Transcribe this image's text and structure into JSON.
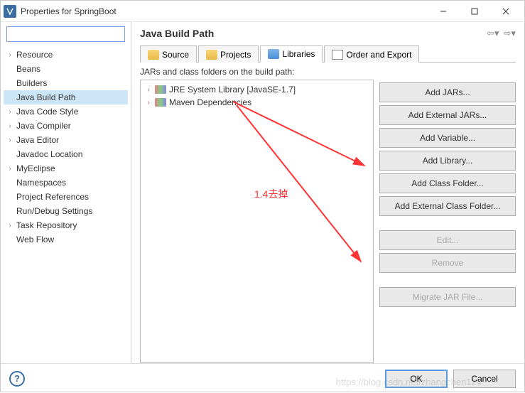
{
  "window": {
    "title": "Properties for SpringBoot"
  },
  "sidebar": {
    "filter_value": "",
    "items": [
      {
        "label": "Resource",
        "expandable": true,
        "selected": false
      },
      {
        "label": "Beans",
        "expandable": false,
        "selected": false
      },
      {
        "label": "Builders",
        "expandable": false,
        "selected": false
      },
      {
        "label": "Java Build Path",
        "expandable": false,
        "selected": true
      },
      {
        "label": "Java Code Style",
        "expandable": true,
        "selected": false
      },
      {
        "label": "Java Compiler",
        "expandable": true,
        "selected": false
      },
      {
        "label": "Java Editor",
        "expandable": true,
        "selected": false
      },
      {
        "label": "Javadoc Location",
        "expandable": false,
        "selected": false
      },
      {
        "label": "MyEclipse",
        "expandable": true,
        "selected": false
      },
      {
        "label": "Namespaces",
        "expandable": false,
        "selected": false
      },
      {
        "label": "Project References",
        "expandable": false,
        "selected": false
      },
      {
        "label": "Run/Debug Settings",
        "expandable": false,
        "selected": false
      },
      {
        "label": "Task Repository",
        "expandable": true,
        "selected": false
      },
      {
        "label": "Web Flow",
        "expandable": false,
        "selected": false
      }
    ]
  },
  "content": {
    "title": "Java Build Path",
    "tabs": [
      {
        "label": "Source",
        "active": false
      },
      {
        "label": "Projects",
        "active": false
      },
      {
        "label": "Libraries",
        "active": true
      },
      {
        "label": "Order and Export",
        "active": false
      }
    ],
    "libraries": {
      "description": "JARs and class folders on the build path:",
      "items": [
        {
          "label": "JRE System Library [JavaSE-1.7]"
        },
        {
          "label": "Maven Dependencies"
        }
      ]
    },
    "buttons": {
      "add_jars": "Add JARs...",
      "add_external_jars": "Add External JARs...",
      "add_variable": "Add Variable...",
      "add_library": "Add Library...",
      "add_class_folder": "Add Class Folder...",
      "add_external_class_folder": "Add External Class Folder...",
      "edit": "Edit...",
      "remove": "Remove",
      "migrate_jar": "Migrate JAR File..."
    }
  },
  "footer": {
    "ok": "OK",
    "cancel": "Cancel"
  },
  "annotation": {
    "text": "1.4去掉"
  },
  "watermark": "https://blog.csdn.net/zhangchen124"
}
